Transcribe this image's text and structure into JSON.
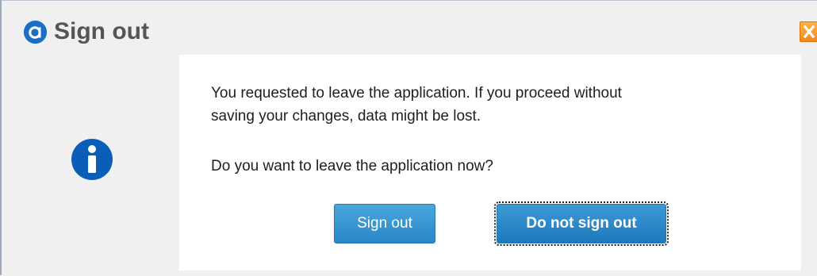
{
  "dialog": {
    "title": "Sign out",
    "icons": {
      "app_logo": "app-logo-icon",
      "close": "close-icon",
      "info": "info-icon"
    },
    "message": {
      "line1": "You requested to leave the application. If you proceed without",
      "line2": "saving your changes, data might be lost.",
      "question": "Do you want to leave the application now?"
    },
    "buttons": {
      "sign_out_label": "Sign out",
      "do_not_sign_out_label": "Do not sign out"
    },
    "colors": {
      "accent_blue": "#2a86c6",
      "info_icon_blue": "#0b5eb8",
      "close_orange": "#f28a1c",
      "title_gray": "#555555"
    }
  }
}
